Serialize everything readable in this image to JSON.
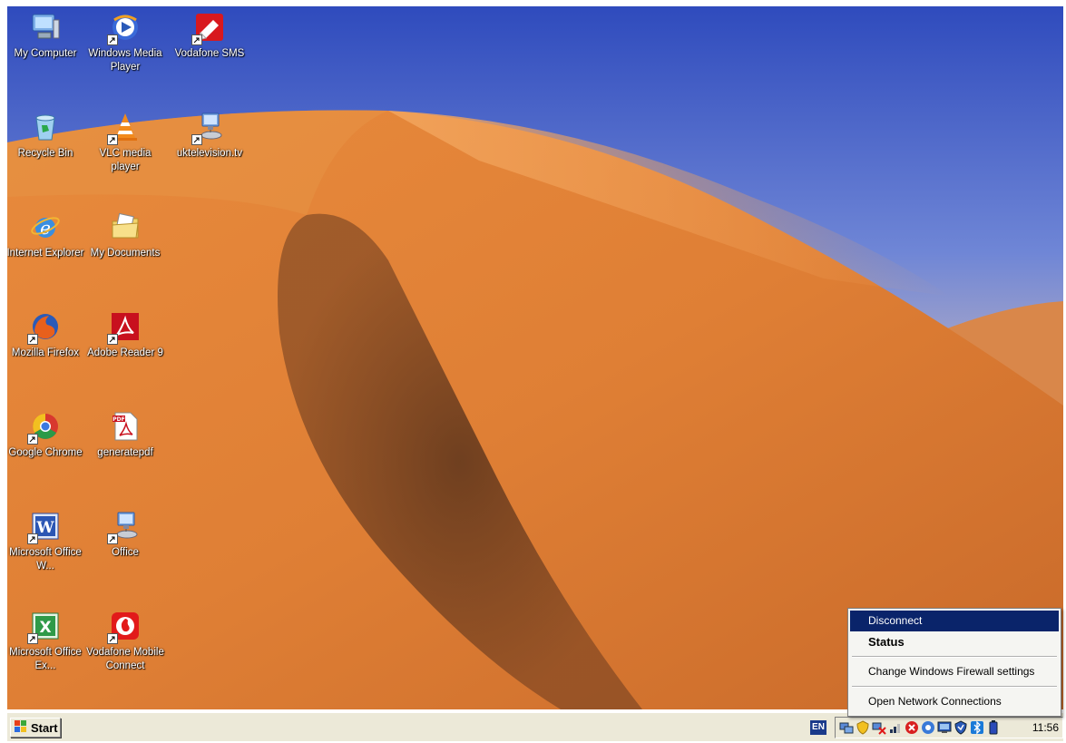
{
  "desktop": {
    "icons": [
      {
        "label": "My Computer",
        "icon": "my-computer-icon"
      },
      {
        "label": "Windows Media Player",
        "icon": "windows-media-player-icon"
      },
      {
        "label": "Vodafone SMS",
        "icon": "vodafone-sms-icon"
      },
      {
        "label": "Recycle Bin",
        "icon": "recycle-bin-icon"
      },
      {
        "label": "VLC media player",
        "icon": "vlc-icon"
      },
      {
        "label": "uktelevision.tv",
        "icon": "network-computer-icon"
      },
      {
        "label": "Internet Explorer",
        "icon": "internet-explorer-icon"
      },
      {
        "label": "My Documents",
        "icon": "my-documents-icon"
      },
      {
        "label": "Mozilla Firefox",
        "icon": "firefox-icon"
      },
      {
        "label": "Adobe Reader 9",
        "icon": "adobe-reader-icon"
      },
      {
        "label": "Google Chrome",
        "icon": "chrome-icon"
      },
      {
        "label": "generatepdf",
        "icon": "pdf-file-icon"
      },
      {
        "label": "Microsoft Office W...",
        "icon": "word-icon"
      },
      {
        "label": "Office",
        "icon": "network-computer-icon"
      },
      {
        "label": "Microsoft Office Ex...",
        "icon": "excel-icon"
      },
      {
        "label": "Vodafone Mobile Connect",
        "icon": "vodafone-icon"
      }
    ]
  },
  "taskbar": {
    "start_label": "Start",
    "language": "EN",
    "clock": "11:56"
  },
  "context_menu": {
    "items": [
      {
        "label": "Disconnect",
        "highlighted": true
      },
      {
        "label": "Status",
        "bold": true
      },
      {
        "label": "Change Windows Firewall settings"
      },
      {
        "label": "Open Network Connections"
      }
    ]
  }
}
